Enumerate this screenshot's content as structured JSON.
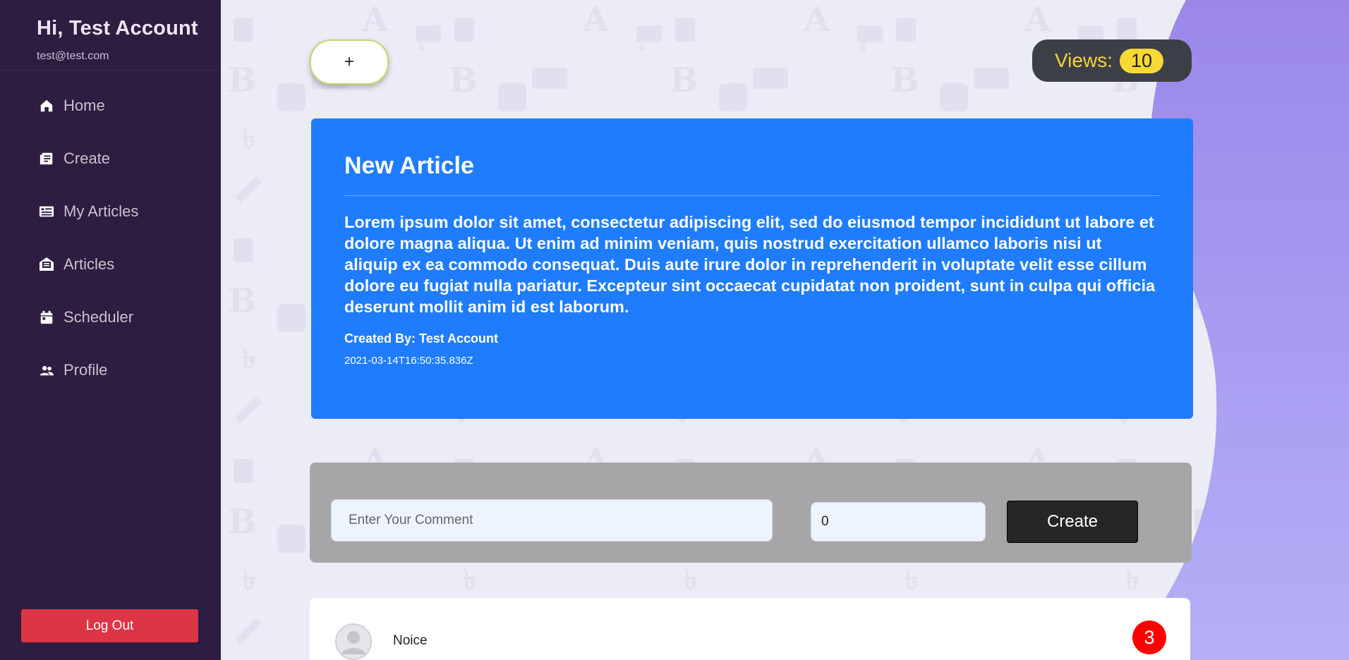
{
  "sidebar": {
    "greeting": "Hi, Test Account",
    "email": "test@test.com",
    "items": [
      {
        "label": "Home",
        "icon": "home-icon"
      },
      {
        "label": "Create",
        "icon": "create-icon"
      },
      {
        "label": "My Articles",
        "icon": "my-articles-icon"
      },
      {
        "label": "Articles",
        "icon": "articles-icon"
      },
      {
        "label": "Scheduler",
        "icon": "calendar-icon"
      },
      {
        "label": "Profile",
        "icon": "people-icon"
      }
    ],
    "logout_label": "Log Out"
  },
  "toolbar": {
    "add_label": "+",
    "views_label": "Views:",
    "views_count": "10"
  },
  "article": {
    "title": "New Article",
    "body": "Lorem ipsum dolor sit amet, consectetur adipiscing elit, sed do eiusmod tempor incididunt ut labore et dolore magna aliqua. Ut enim ad minim veniam, quis nostrud exercitation ullamco laboris nisi ut aliquip ex ea commodo consequat. Duis aute irure dolor in reprehenderit in voluptate velit esse cillum dolore eu fugiat nulla pariatur. Excepteur sint occaecat cupidatat non proident, sunt in culpa qui officia deserunt mollit anim id est laborum.",
    "created_by": "Created By: Test Account",
    "date": "2021-03-14T16:50:35.836Z"
  },
  "comment_form": {
    "placeholder": "Enter Your Comment",
    "number_value": "0",
    "create_label": "Create"
  },
  "comments": [
    {
      "text": "Noice",
      "count": "3"
    }
  ],
  "colors": {
    "sidebar_bg": "#2f1c41",
    "article_bg": "#1e7cfd",
    "logout_bg": "#dc3545",
    "views_accent": "#f8d835",
    "badge_red": "#ff0000"
  }
}
